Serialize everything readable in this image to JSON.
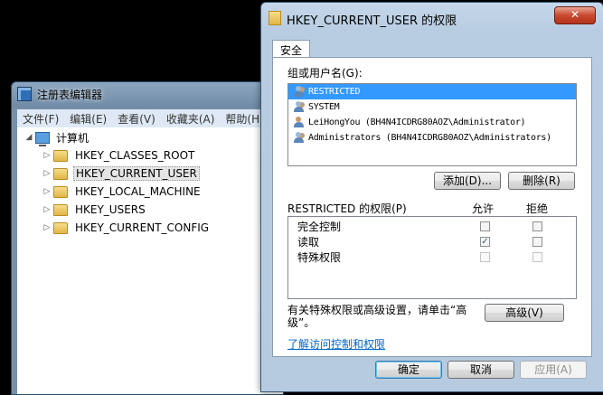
{
  "regedit": {
    "title": "注册表编辑器",
    "menu": [
      "文件(F)",
      "编辑(E)",
      "查看(V)",
      "收藏夹(A)",
      "帮助(H)"
    ],
    "root": "计算机",
    "keys": [
      "HKEY_CLASSES_ROOT",
      "HKEY_CURRENT_USER",
      "HKEY_LOCAL_MACHINE",
      "HKEY_USERS",
      "HKEY_CURRENT_CONFIG"
    ],
    "selected_key": "HKEY_CURRENT_USER"
  },
  "dialog": {
    "title": "HKEY_CURRENT_USER 的权限",
    "close_label": "✕",
    "tab": "安全",
    "group_label": "组或用户名(G):",
    "users": [
      {
        "name": "RESTRICTED",
        "icon": "group-icon",
        "selected": true
      },
      {
        "name": "SYSTEM",
        "icon": "group-icon",
        "selected": false
      },
      {
        "name": "LeiHongYou (BH4N4ICDRG80AOZ\\Administrator)",
        "icon": "user-icon",
        "selected": false
      },
      {
        "name": "Administrators (BH4N4ICDRG80AOZ\\Administrators)",
        "icon": "group-icon",
        "selected": false
      }
    ],
    "add_button": "添加(D)...",
    "remove_button": "删除(R)",
    "perm_header": "RESTRICTED 的权限(P)",
    "allow_header": "允许",
    "deny_header": "拒绝",
    "permissions": [
      {
        "name": "完全控制",
        "allow": false,
        "deny": false,
        "enabled": true
      },
      {
        "name": "读取",
        "allow": true,
        "deny": false,
        "enabled": true
      },
      {
        "name": "特殊权限",
        "allow": false,
        "deny": false,
        "enabled": false
      }
    ],
    "advanced_text": "有关特殊权限或高级设置，请单击“高级”。",
    "advanced_button": "高级(V)",
    "link": "了解访问控制和权限",
    "ok_button": "确定",
    "cancel_button": "取消",
    "apply_button": "应用(A)"
  }
}
